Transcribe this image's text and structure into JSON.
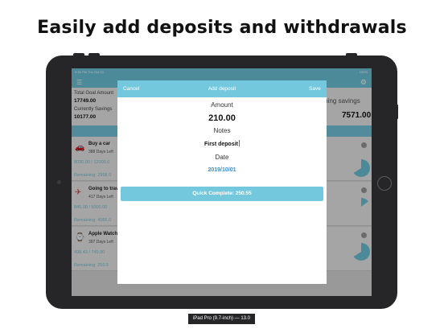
{
  "headline": "Easily add deposits and withdrawals",
  "status_bar": {
    "time": "9:36 PM   Thu Oct 10",
    "battery": "100%"
  },
  "nav": {
    "menu_icon": "menu-icon",
    "settings_icon": "gear-icon"
  },
  "summary": {
    "total_goal_label": "Total Goal Amount",
    "total_goal_value": "17749.00",
    "current_savings_label": "Currently Savings",
    "current_savings_value": "10177.00",
    "remaining_label": "aining savings",
    "remaining_value": "7571.00"
  },
  "goals": [
    {
      "icon": "car-icon",
      "title": "Buy a car",
      "days": "388 Days Left",
      "progress": "8030.00 / 12000.0",
      "remaining": "Remaining: 2998.0",
      "pie_percent": 66
    },
    {
      "icon": "plane-icon",
      "title": "Going to trav",
      "days": "417 Days Left",
      "progress": "845.00 / 5000.00",
      "remaining": "Remaining: 4055.0",
      "pie_percent": 15
    },
    {
      "icon": "watch-icon",
      "title": "Apple Watch",
      "days": "397 Days Left",
      "progress": "498.43 / 749.00",
      "remaining": "Remaining: 250.5",
      "pie_percent": 66
    }
  ],
  "dialog": {
    "cancel_label": "Cancel",
    "title": "Add deposit",
    "save_label": "Save",
    "amount_label": "Amount",
    "amount_value": "210.00",
    "notes_label": "Notes",
    "notes_value": "First deposit",
    "date_label": "Date",
    "date_value": "2019/10/01",
    "quick_complete_label": "Quick Complete: 250.55"
  },
  "device_label": "iPad Pro (9.7-inch) — 13.0",
  "colors": {
    "accent": "#74c8de",
    "link": "#3b8ec9",
    "device": "#262628"
  }
}
